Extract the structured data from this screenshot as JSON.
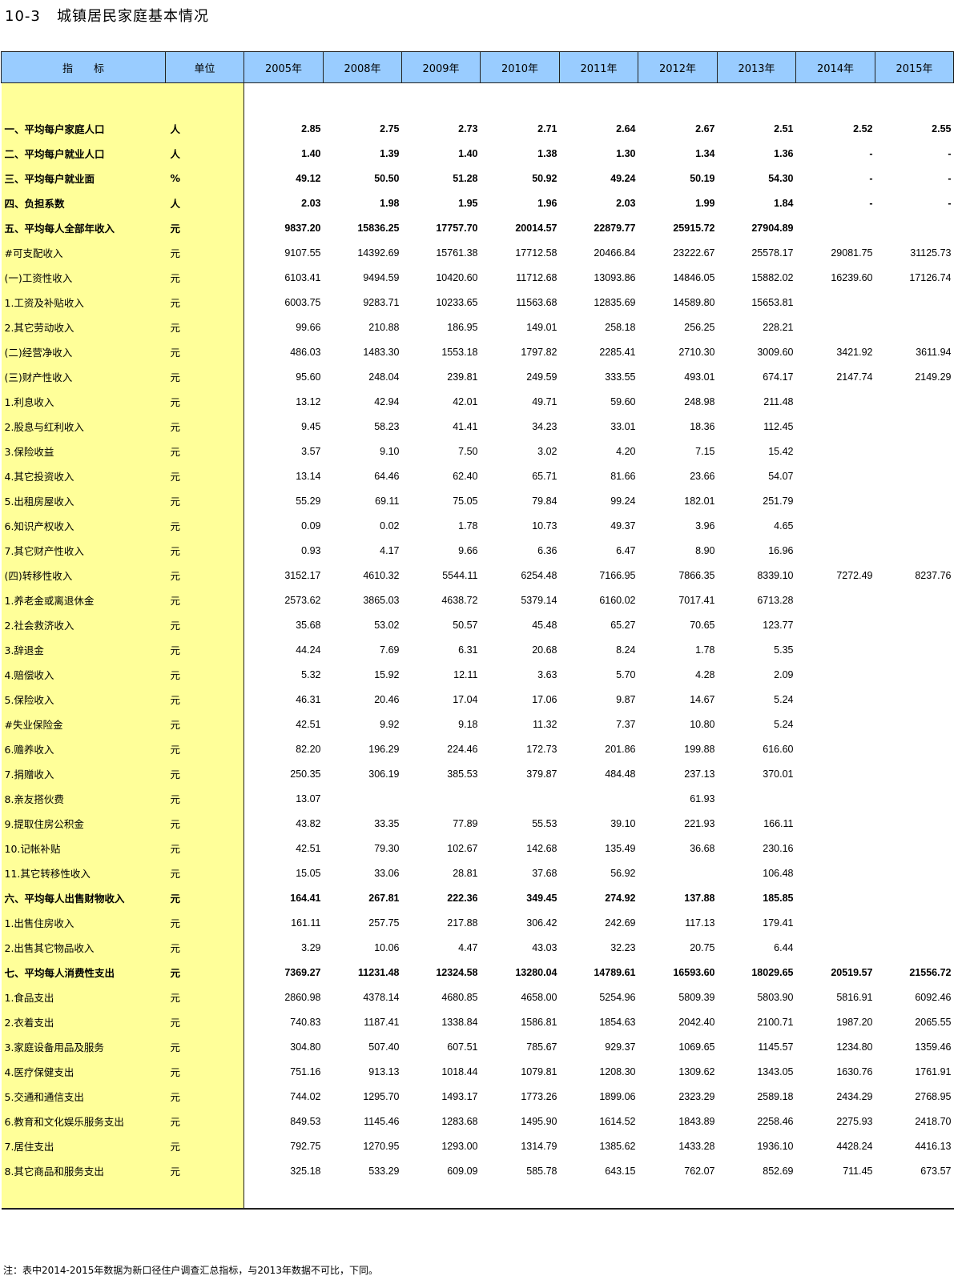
{
  "title": "10-3   城镇居民家庭基本情况",
  "header": {
    "indicator": "指　　标",
    "unit": "单位",
    "years": [
      "2005年",
      "2008年",
      "2009年",
      "2010年",
      "2011年",
      "2012年",
      "2013年",
      "2014年",
      "2015年"
    ]
  },
  "rows": [
    {
      "label": "一、平均每户家庭人口",
      "unit": "人",
      "bold": true,
      "indent": 0,
      "values": [
        "2.85",
        "2.75",
        "2.73",
        "2.71",
        "2.64",
        "2.67",
        "2.51",
        "2.52",
        "2.55"
      ]
    },
    {
      "label": "二、平均每户就业人口",
      "unit": "人",
      "bold": true,
      "indent": 0,
      "values": [
        "1.40",
        "1.39",
        "1.40",
        "1.38",
        "1.30",
        "1.34",
        "1.36",
        "-",
        "-"
      ]
    },
    {
      "label": "三、平均每户就业面",
      "unit": "%",
      "bold": true,
      "indent": 0,
      "values": [
        "49.12",
        "50.50",
        "51.28",
        "50.92",
        "49.24",
        "50.19",
        "54.30",
        "-",
        "-"
      ]
    },
    {
      "label": "四、负担系数",
      "unit": "人",
      "bold": true,
      "indent": 0,
      "values": [
        "2.03",
        "1.98",
        "1.95",
        "1.96",
        "2.03",
        "1.99",
        "1.84",
        "-",
        "-"
      ]
    },
    {
      "label": "五、平均每人全部年收入",
      "unit": "元",
      "bold": true,
      "indent": 0,
      "values": [
        "9837.20",
        "15836.25",
        "17757.70",
        "20014.57",
        "22879.77",
        "25915.72",
        "27904.89",
        "",
        ""
      ]
    },
    {
      "label": "#可支配收入",
      "unit": "元",
      "bold": false,
      "indent": 28,
      "values": [
        "9107.55",
        "14392.69",
        "15761.38",
        "17712.58",
        "20466.84",
        "23222.67",
        "25578.17",
        "29081.75",
        "31125.73"
      ]
    },
    {
      "label": "(一)工资性收入",
      "unit": "元",
      "bold": false,
      "indent": 0,
      "values": [
        "6103.41",
        "9494.59",
        "10420.60",
        "11712.68",
        "13093.86",
        "14846.05",
        "15882.02",
        "16239.60",
        "17126.74"
      ]
    },
    {
      "label": "1.工资及补贴收入",
      "unit": "元",
      "bold": false,
      "indent": 18,
      "values": [
        "6003.75",
        "9283.71",
        "10233.65",
        "11563.68",
        "12835.69",
        "14589.80",
        "15653.81",
        "",
        ""
      ]
    },
    {
      "label": "2.其它劳动收入",
      "unit": "元",
      "bold": false,
      "indent": 18,
      "values": [
        "99.66",
        "210.88",
        "186.95",
        "149.01",
        "258.18",
        "256.25",
        "228.21",
        "",
        ""
      ]
    },
    {
      "label": "(二)经营净收入",
      "unit": "元",
      "bold": false,
      "indent": 0,
      "values": [
        "486.03",
        "1483.30",
        "1553.18",
        "1797.82",
        "2285.41",
        "2710.30",
        "3009.60",
        "3421.92",
        "3611.94"
      ]
    },
    {
      "label": "(三)财产性收入",
      "unit": "元",
      "bold": false,
      "indent": 0,
      "values": [
        "95.60",
        "248.04",
        "239.81",
        "249.59",
        "333.55",
        "493.01",
        "674.17",
        "2147.74",
        "2149.29"
      ]
    },
    {
      "label": "1.利息收入",
      "unit": "元",
      "bold": false,
      "indent": 18,
      "values": [
        "13.12",
        "42.94",
        "42.01",
        "49.71",
        "59.60",
        "248.98",
        "211.48",
        "",
        ""
      ]
    },
    {
      "label": "2.股息与红利收入",
      "unit": "元",
      "bold": false,
      "indent": 18,
      "values": [
        "9.45",
        "58.23",
        "41.41",
        "34.23",
        "33.01",
        "18.36",
        "112.45",
        "",
        ""
      ]
    },
    {
      "label": "3.保险收益",
      "unit": "元",
      "bold": false,
      "indent": 18,
      "values": [
        "3.57",
        "9.10",
        "7.50",
        "3.02",
        "4.20",
        "7.15",
        "15.42",
        "",
        ""
      ]
    },
    {
      "label": "4.其它投资收入",
      "unit": "元",
      "bold": false,
      "indent": 18,
      "values": [
        "13.14",
        "64.46",
        "62.40",
        "65.71",
        "81.66",
        "23.66",
        "54.07",
        "",
        ""
      ]
    },
    {
      "label": "5.出租房屋收入",
      "unit": "元",
      "bold": false,
      "indent": 18,
      "values": [
        "55.29",
        "69.11",
        "75.05",
        "79.84",
        "99.24",
        "182.01",
        "251.79",
        "",
        ""
      ]
    },
    {
      "label": "6.知识产权收入",
      "unit": "元",
      "bold": false,
      "indent": 18,
      "values": [
        "0.09",
        "0.02",
        "1.78",
        "10.73",
        "49.37",
        "3.96",
        "4.65",
        "",
        ""
      ]
    },
    {
      "label": "7.其它财产性收入",
      "unit": "元",
      "bold": false,
      "indent": 18,
      "values": [
        "0.93",
        "4.17",
        "9.66",
        "6.36",
        "6.47",
        "8.90",
        "16.96",
        "",
        ""
      ]
    },
    {
      "label": "(四)转移性收入",
      "unit": "元",
      "bold": false,
      "indent": 0,
      "values": [
        "3152.17",
        "4610.32",
        "5544.11",
        "6254.48",
        "7166.95",
        "7866.35",
        "8339.10",
        "7272.49",
        "8237.76"
      ]
    },
    {
      "label": "1.养老金或离退休金",
      "unit": "元",
      "bold": false,
      "indent": 24,
      "values": [
        "2573.62",
        "3865.03",
        "4638.72",
        "5379.14",
        "6160.02",
        "7017.41",
        "6713.28",
        "",
        ""
      ]
    },
    {
      "label": "2.社会救济收入",
      "unit": "元",
      "bold": false,
      "indent": 24,
      "values": [
        "35.68",
        "53.02",
        "50.57",
        "45.48",
        "65.27",
        "70.65",
        "123.77",
        "",
        ""
      ]
    },
    {
      "label": "3.辞退金",
      "unit": "元",
      "bold": false,
      "indent": 24,
      "values": [
        "44.24",
        "7.69",
        "6.31",
        "20.68",
        "8.24",
        "1.78",
        "5.35",
        "",
        ""
      ]
    },
    {
      "label": "4.赔偿收入",
      "unit": "元",
      "bold": false,
      "indent": 24,
      "values": [
        "5.32",
        "15.92",
        "12.11",
        "3.63",
        "5.70",
        "4.28",
        "2.09",
        "",
        ""
      ]
    },
    {
      "label": "5.保险收入",
      "unit": "元",
      "bold": false,
      "indent": 24,
      "values": [
        "46.31",
        "20.46",
        "17.04",
        "17.06",
        "9.87",
        "14.67",
        "5.24",
        "",
        ""
      ]
    },
    {
      "label": "#失业保险金",
      "unit": "元",
      "bold": false,
      "indent": 40,
      "values": [
        "42.51",
        "9.92",
        "9.18",
        "11.32",
        "7.37",
        "10.80",
        "5.24",
        "",
        ""
      ]
    },
    {
      "label": "6.赡养收入",
      "unit": "元",
      "bold": false,
      "indent": 24,
      "values": [
        "82.20",
        "196.29",
        "224.46",
        "172.73",
        "201.86",
        "199.88",
        "616.60",
        "",
        ""
      ]
    },
    {
      "label": "7.捐赠收入",
      "unit": "元",
      "bold": false,
      "indent": 24,
      "values": [
        "250.35",
        "306.19",
        "385.53",
        "379.87",
        "484.48",
        "237.13",
        "370.01",
        "",
        ""
      ]
    },
    {
      "label": "8.亲友搭伙费",
      "unit": "元",
      "bold": false,
      "indent": 24,
      "values": [
        "13.07",
        "",
        "",
        "",
        "",
        "61.93",
        "",
        "",
        ""
      ]
    },
    {
      "label": "9.提取住房公积金",
      "unit": "元",
      "bold": false,
      "indent": 24,
      "values": [
        "43.82",
        "33.35",
        "77.89",
        "55.53",
        "39.10",
        "221.93",
        "166.11",
        "",
        ""
      ]
    },
    {
      "label": "10.记帐补贴",
      "unit": "元",
      "bold": false,
      "indent": 24,
      "values": [
        "42.51",
        "79.30",
        "102.67",
        "142.68",
        "135.49",
        "36.68",
        "230.16",
        "",
        ""
      ]
    },
    {
      "label": "11.其它转移性收入",
      "unit": "元",
      "bold": false,
      "indent": 24,
      "values": [
        "15.05",
        "33.06",
        "28.81",
        "37.68",
        "56.92",
        "",
        "106.48",
        "",
        ""
      ]
    },
    {
      "label": "六、平均每人出售财物收入",
      "unit": "元",
      "bold": true,
      "indent": 0,
      "values": [
        "164.41",
        "267.81",
        "222.36",
        "349.45",
        "274.92",
        "137.88",
        "185.85",
        "",
        ""
      ]
    },
    {
      "label": "1.出售住房收入",
      "unit": "元",
      "bold": false,
      "indent": 24,
      "values": [
        "161.11",
        "257.75",
        "217.88",
        "306.42",
        "242.69",
        "117.13",
        "179.41",
        "",
        ""
      ]
    },
    {
      "label": "2.出售其它物品收入",
      "unit": "元",
      "bold": false,
      "indent": 24,
      "values": [
        "3.29",
        "10.06",
        "4.47",
        "43.03",
        "32.23",
        "20.75",
        "6.44",
        "",
        ""
      ]
    },
    {
      "label": "七、平均每人消费性支出",
      "unit": "元",
      "bold": true,
      "indent": 0,
      "values": [
        "7369.27",
        "11231.48",
        "12324.58",
        "13280.04",
        "14789.61",
        "16593.60",
        "18029.65",
        "20519.57",
        "21556.72"
      ]
    },
    {
      "label": "1.食品支出",
      "unit": "元",
      "bold": false,
      "indent": 24,
      "values": [
        "2860.98",
        "4378.14",
        "4680.85",
        "4658.00",
        "5254.96",
        "5809.39",
        "5803.90",
        "5816.91",
        "6092.46"
      ]
    },
    {
      "label": "2.衣着支出",
      "unit": "元",
      "bold": false,
      "indent": 24,
      "values": [
        "740.83",
        "1187.41",
        "1338.84",
        "1586.81",
        "1854.63",
        "2042.40",
        "2100.71",
        "1987.20",
        "2065.55"
      ]
    },
    {
      "label": "3.家庭设备用品及服务",
      "unit": "元",
      "bold": false,
      "indent": 24,
      "values": [
        "304.80",
        "507.40",
        "607.51",
        "785.67",
        "929.37",
        "1069.65",
        "1145.57",
        "1234.80",
        "1359.46"
      ]
    },
    {
      "label": "4.医疗保健支出",
      "unit": "元",
      "bold": false,
      "indent": 24,
      "values": [
        "751.16",
        "913.13",
        "1018.44",
        "1079.81",
        "1208.30",
        "1309.62",
        "1343.05",
        "1630.76",
        "1761.91"
      ]
    },
    {
      "label": "5.交通和通信支出",
      "unit": "元",
      "bold": false,
      "indent": 24,
      "values": [
        "744.02",
        "1295.70",
        "1493.17",
        "1773.26",
        "1899.06",
        "2323.29",
        "2589.18",
        "2434.29",
        "2768.95"
      ]
    },
    {
      "label": "6.教育和文化娱乐服务支出",
      "unit": "元",
      "bold": false,
      "indent": 24,
      "values": [
        "849.53",
        "1145.46",
        "1283.68",
        "1495.90",
        "1614.52",
        "1843.89",
        "2258.46",
        "2275.93",
        "2418.70"
      ]
    },
    {
      "label": "7.居住支出",
      "unit": "元",
      "bold": false,
      "indent": 24,
      "values": [
        "792.75",
        "1270.95",
        "1293.00",
        "1314.79",
        "1385.62",
        "1433.28",
        "1936.10",
        "4428.24",
        "4416.13"
      ]
    },
    {
      "label": "8.其它商品和服务支出",
      "unit": "元",
      "bold": false,
      "indent": 24,
      "values": [
        "325.18",
        "533.29",
        "609.09",
        "585.78",
        "643.15",
        "762.07",
        "852.69",
        "711.45",
        "673.57"
      ]
    }
  ],
  "footnote": "注：表中2014-2015年数据为新口径住户调查汇总指标，与2013年数据不可比，下同。"
}
